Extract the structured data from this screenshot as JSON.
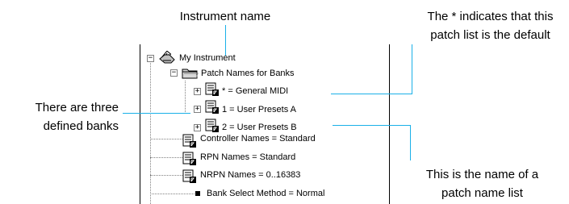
{
  "annotations": {
    "instrument_name": "Instrument name",
    "default_note_line1": "The * indicates that this",
    "default_note_line2": "patch list is the default",
    "banks_note_line1": "There are three",
    "banks_note_line2": "defined banks",
    "patch_list_note_line1": "This is the name of a",
    "patch_list_note_line2": "patch name list"
  },
  "tree": {
    "root": "My Instrument",
    "patch_names_folder": "Patch Names for Banks",
    "banks": [
      "* = General MIDI",
      "1 = User Presets A",
      "2 = User Presets B"
    ],
    "controller_names": "Controller Names = Standard",
    "rpn_names": "RPN Names = Standard",
    "nrpn_names": "NRPN Names = 0..16383",
    "bank_select": "Bank Select Method = Normal",
    "expanded_glyph": "−",
    "collapsed_glyph": "+"
  },
  "colors": {
    "leader_line": "#1ab0e8",
    "tree_line": "#808080"
  },
  "icons": [
    "instrument-icon",
    "folder-icon",
    "patch-list-icon",
    "bullet-icon"
  ]
}
